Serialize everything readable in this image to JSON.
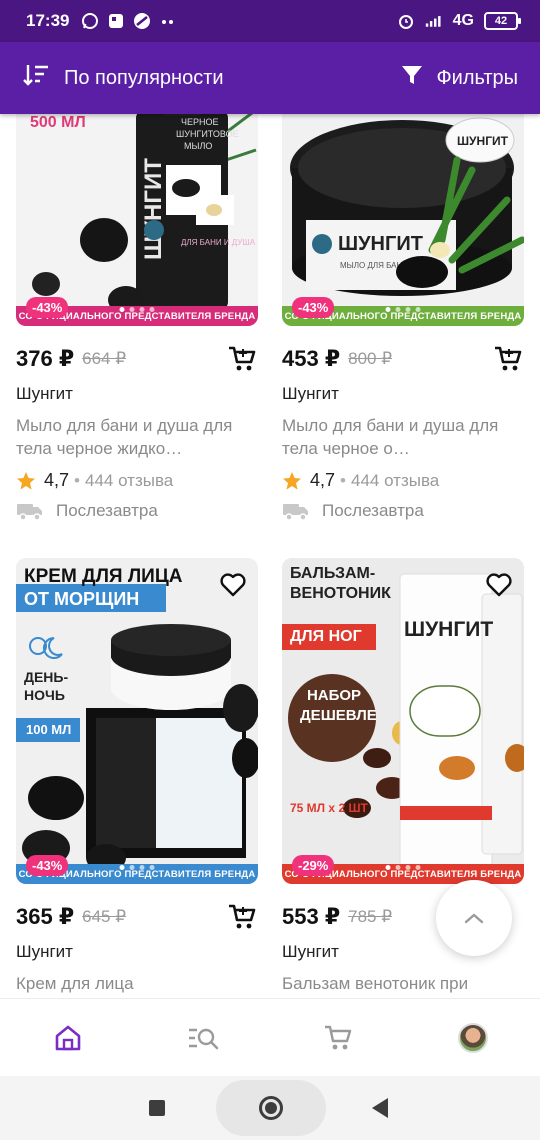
{
  "status_bar": {
    "time": "17:39",
    "network": "4G",
    "battery": "42"
  },
  "app_bar": {
    "sort_label": "По популярности",
    "filter_label": "Фильтры"
  },
  "colors": {
    "app_bar": "#5b1fa6",
    "status_bar": "#4a1682",
    "discount": "#f0327d",
    "accent": "#7b2cc4",
    "star": "#f6a623"
  },
  "products": [
    {
      "photo_text": "500 МЛ",
      "photo_label": "ШУНГИТ",
      "brand_strip": "СО ОФИЦИАЛЬНОГО ПРЕДСТАВИТЕЛЯ БРЕНДА",
      "discount": "-43%",
      "price": "376 ₽",
      "old_price": "664 ₽",
      "brand": "Шунгит",
      "description": "Мыло для бани и душа для тела черное жидко…",
      "rating": "4,7",
      "reviews": "444 отзыва",
      "delivery": "Послезавтра"
    },
    {
      "photo_text": "",
      "photo_label": "ШУНГИТ",
      "brand_strip": "СО ОФИЦИАЛЬНОГО ПРЕДСТАВИТЕЛЯ БРЕНДА",
      "discount": "-43%",
      "price": "453 ₽",
      "old_price": "800 ₽",
      "brand": "Шунгит",
      "description": "Мыло для бани и душа для тела черное о…",
      "rating": "4,7",
      "reviews": "444 отзыва",
      "delivery": "Послезавтра"
    },
    {
      "photo_text": "КРЕМ ДЛЯ ЛИЦА",
      "photo_sub": "ОТ МОРЩИН",
      "photo_label": "ДЕНЬ-НОЧЬ",
      "photo_volume": "100 МЛ",
      "brand_strip": "СО ОФИЦИАЛЬНОГО ПРЕДСТАВИТЕЛЯ БРЕНДА",
      "discount": "-43%",
      "price": "365 ₽",
      "old_price": "645 ₽",
      "brand": "Шунгит",
      "description": "Крем для лица"
    },
    {
      "photo_text": "БАЛЬЗАМ-ВЕНОТОНИК",
      "photo_sub": "ДЛЯ НОГ",
      "photo_label": "ШУНГИТ",
      "photo_badge": "НАБОР ДЕШЕВЛЕ",
      "photo_volume": "75 МЛ х 2 ШТ",
      "brand_strip": "СО ОФИЦИАЛЬНОГО ПРЕДСТАВИТЕЛЯ БРЕНДА",
      "discount": "-29%",
      "price": "553 ₽",
      "old_price": "785 ₽",
      "brand": "Шунгит",
      "description": "Бальзам венотоник при"
    }
  ],
  "icons": {
    "sort": "sort-icon",
    "filter": "filter-icon",
    "cart": "cart-icon",
    "heart": "heart-icon",
    "star": "star-icon",
    "truck": "truck-icon",
    "home": "home-icon",
    "catalog": "catalog-search-icon",
    "basket": "basket-icon",
    "profile": "avatar",
    "scroll_up": "chevron-up-icon"
  }
}
